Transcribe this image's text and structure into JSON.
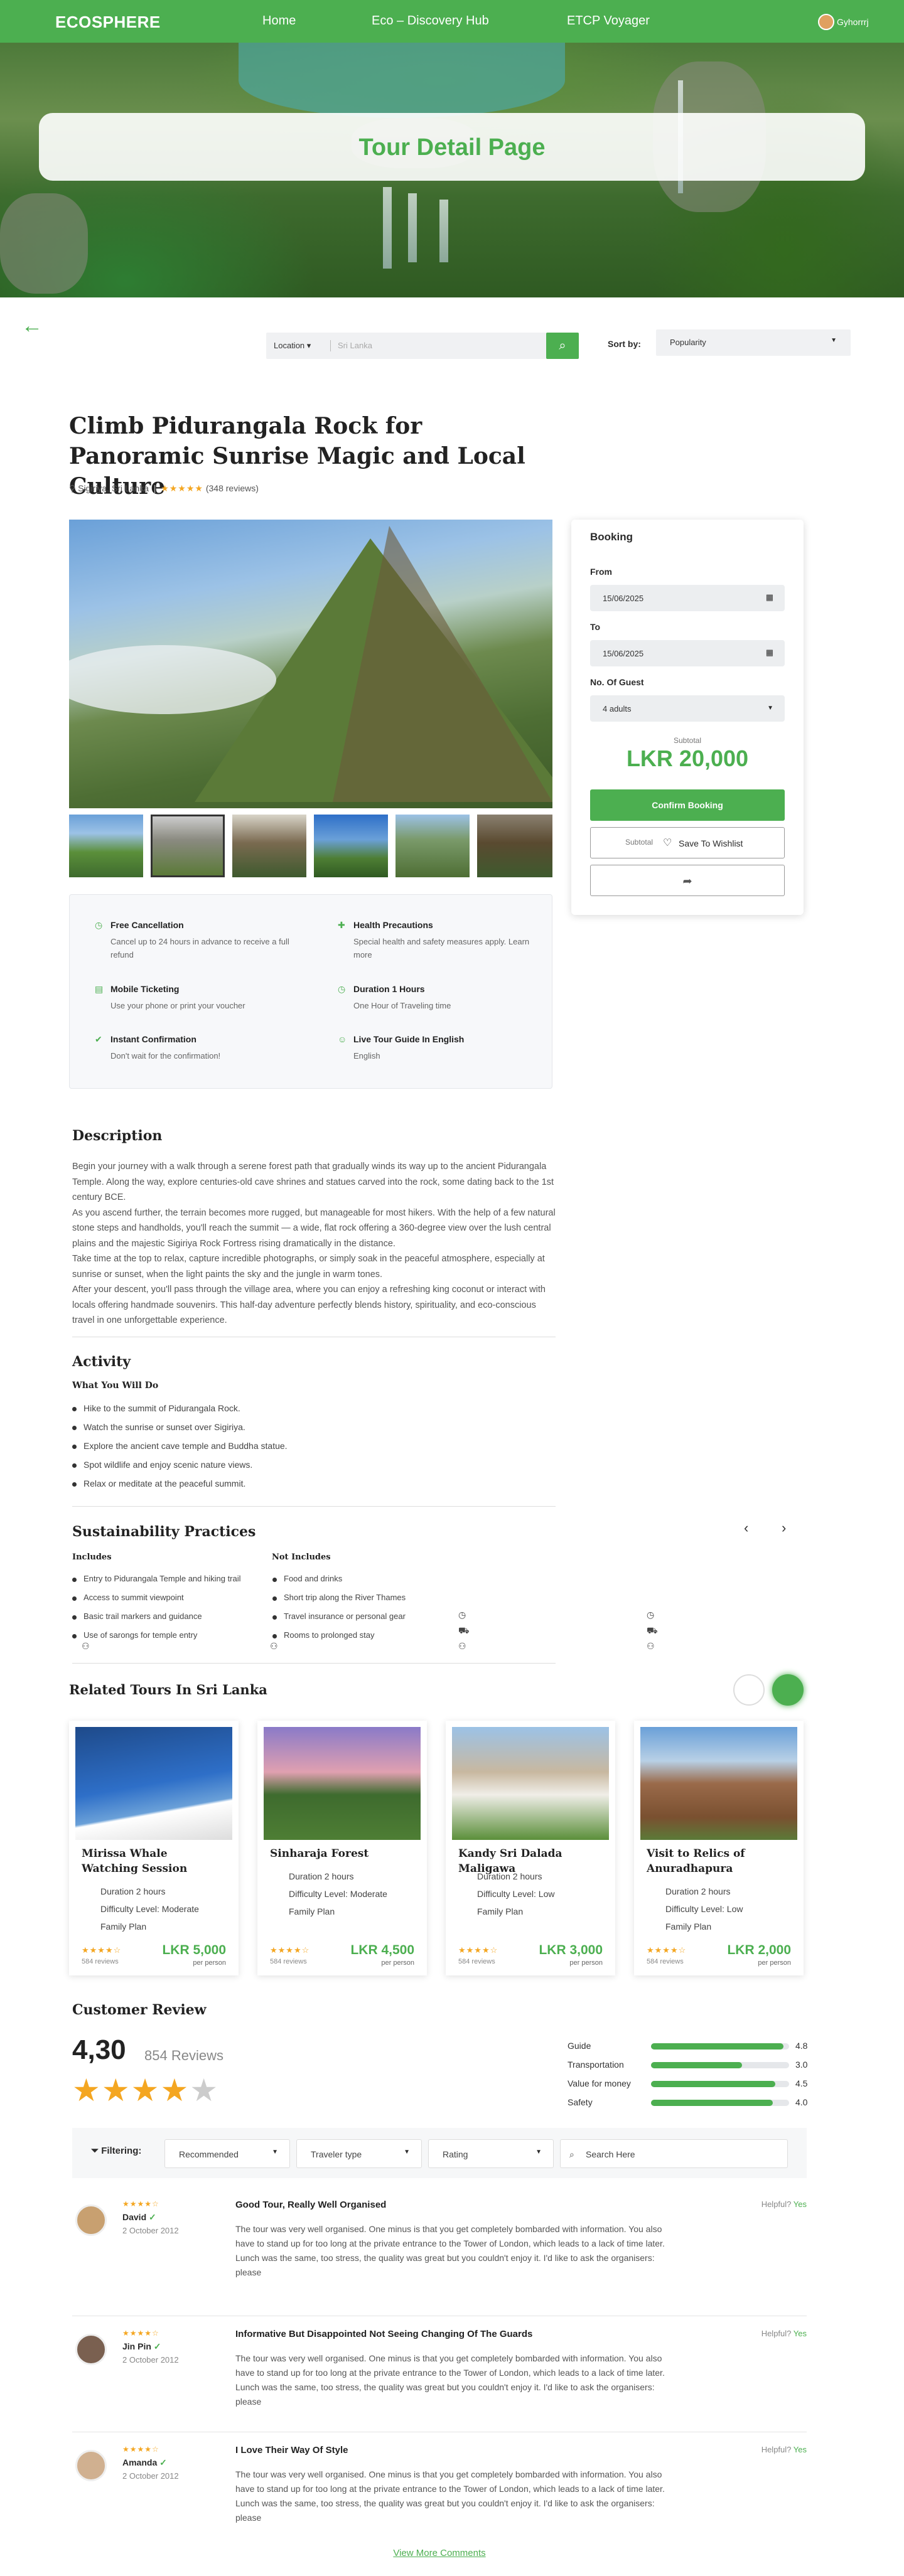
{
  "nav": {
    "logo": "ECOSPHERE",
    "links": [
      "Home",
      "Eco – Discovery Hub",
      "ETCP Voyager"
    ],
    "user": "Gyhorrrj"
  },
  "hero": {
    "title": "Tour Detail Page"
  },
  "search": {
    "location": "Location",
    "placeholder": "Sri Lanka",
    "sort_label": "Sort by:",
    "sort_value": "Popularity"
  },
  "tour": {
    "title": "Climb Pidurangala Rock for Panoramic Sunrise Magic and Local Culture",
    "location": "Sigiriya, Sri Lanka",
    "stars": "★★★★★",
    "reviews": "(348 reviews)"
  },
  "booking": {
    "heading": "Booking",
    "from_label": "From",
    "from": "15/06/2025",
    "to_label": "To",
    "to": "15/06/2025",
    "guest_label": "No. Of Guest",
    "guests": "4 adults",
    "subtotal_label": "Subtotal",
    "price": "LKR 20,000",
    "confirm": "Confirm Booking",
    "wish_sub": "Subtotal",
    "wish": "Save To Wishlist"
  },
  "features": [
    {
      "title": "Free Cancellation",
      "desc": "Cancel up to 24 hours in advance to receive a full refund"
    },
    {
      "title": "Health Precautions",
      "desc": "Special health and safety measures apply. Learn more"
    },
    {
      "title": "Mobile Ticketing",
      "desc": "Use your phone or print your voucher"
    },
    {
      "title": "Duration 1 Hours",
      "desc": "One Hour of Traveling time"
    },
    {
      "title": "Instant Confirmation",
      "desc": "Don't wait for the confirmation!"
    },
    {
      "title": "Live Tour Guide In English",
      "desc": "English"
    }
  ],
  "description": {
    "heading": "Description",
    "text": "Begin your journey with a walk through a serene forest path that gradually winds its way up to the ancient Pidurangala Temple. Along the way, explore centuries-old cave shrines and statues carved into the rock, some dating back to the 1st century BCE.\nAs you ascend further, the terrain becomes more rugged, but manageable for most hikers. With the help of a few natural stone steps and handholds, you'll reach the summit — a wide, flat rock offering a 360-degree view over the lush central plains and the majestic Sigiriya Rock Fortress rising dramatically in the distance.\nTake time at the top to relax, capture incredible photographs, or simply soak in the peaceful atmosphere, especially at sunrise or sunset, when the light paints the sky and the jungle in warm tones.\nAfter your descent, you'll pass through the village area, where you can enjoy a refreshing king coconut or interact with locals offering handmade souvenirs. This half-day adventure perfectly blends history, spirituality, and eco-conscious travel in one unforgettable experience."
  },
  "activity": {
    "heading": "Activity",
    "sub": "What You Will Do",
    "items": [
      "Hike to the summit of Pidurangala Rock.",
      "Watch the sunrise or sunset over Sigiriya.",
      "Explore the ancient cave temple and Buddha statue.",
      "Spot wildlife and enjoy scenic nature views.",
      "Relax or meditate at the peaceful summit."
    ]
  },
  "sustain": {
    "heading": "Sustainability Practices",
    "inc_label": "Includes",
    "inc": [
      "Entry to Pidurangala Temple and hiking trail",
      "Access to summit viewpoint",
      "Basic trail markers and guidance",
      "Use of sarongs for temple entry"
    ],
    "exc_label": "Not Includes",
    "exc": [
      "Food and drinks",
      "Short trip along the River Thames",
      "Travel insurance or personal gear",
      "Rooms to prolonged stay"
    ]
  },
  "related": {
    "heading": "Related Tours In Sri Lanka",
    "cards": [
      {
        "name": "Mirissa Whale Watching Session",
        "duration": "Duration 2 hours",
        "difficulty": "Difficulty Level: Moderate",
        "plan": "Family Plan",
        "stars": "★★★★☆",
        "reviews": "584 reviews",
        "price": "LKR 5,000",
        "per": "per person"
      },
      {
        "name": "Sinharaja Forest",
        "duration": "Duration 2 hours",
        "difficulty": "Difficulty Level: Moderate",
        "plan": "Family Plan",
        "stars": "★★★★☆",
        "reviews": "584 reviews",
        "price": "LKR 4,500",
        "per": "per person"
      },
      {
        "name": "Kandy Sri Dalada Maligawa",
        "duration": "Duration 2 hours",
        "difficulty": "Difficulty Level: Low",
        "plan": "Family Plan",
        "stars": "★★★★☆",
        "reviews": "584 reviews",
        "price": "LKR 3,000",
        "per": "per person"
      },
      {
        "name": "Visit to Relics of Anuradhapura",
        "duration": "Duration 2 hours",
        "difficulty": "Difficulty Level: Low",
        "plan": "Family Plan",
        "stars": "★★★★☆",
        "reviews": "584 reviews",
        "price": "LKR 2,000",
        "per": "per person"
      }
    ]
  },
  "reviews": {
    "heading": "Customer Review",
    "score": "4,30",
    "count": "854 Reviews",
    "ratings": [
      {
        "label": "Guide",
        "value": "4.8",
        "fill": 0.96
      },
      {
        "label": "Transportation",
        "value": "3.0",
        "fill": 0.66
      },
      {
        "label": "Value for money",
        "value": "4.5",
        "fill": 0.9
      },
      {
        "label": "Safety",
        "value": "4.0",
        "fill": 0.88
      }
    ],
    "filter_label": "Filtering:",
    "filters": [
      "Recommended",
      "Traveler type",
      "Rating"
    ],
    "search_ph": "Search Here",
    "items": [
      {
        "stars": "★★★★☆",
        "name": "David",
        "date": "2 October 2012",
        "title": "Good Tour, Really Well Organised",
        "helpful": "Helpful?",
        "yes": "Yes",
        "text": "The tour was very well organised. One minus is that you get completely bombarded with information. You also have to stand up for too long at the private entrance to the Tower of London, which leads to a lack of time later. Lunch was the same, too stress, the quality was great but you couldn't enjoy it. I'd like to ask the organisers: please"
      },
      {
        "stars": "★★★★☆",
        "name": "Jin Pin",
        "date": "2 October 2012",
        "title": "Informative But Disappointed Not Seeing Changing Of The Guards",
        "helpful": "Helpful?",
        "yes": "Yes",
        "text": "The tour was very well organised. One minus is that you get completely bombarded with information. You also have to stand up for too long at the private entrance to the Tower of London, which leads to a lack of time later. Lunch was the same, too stress, the quality was great but you couldn't enjoy it. I'd like to ask the organisers: please"
      },
      {
        "stars": "★★★★☆",
        "name": "Amanda",
        "date": "2 October 2012",
        "title": "I Love Their Way Of Style",
        "helpful": "Helpful?",
        "yes": "Yes",
        "text": "The tour was very well organised. One minus is that you get completely bombarded with information. You also have to stand up for too long at the private entrance to the Tower of London, which leads to a lack of time later. Lunch was the same, too stress, the quality was great but you couldn't enjoy it. I'd like to ask the organisers: please"
      }
    ],
    "more": "View More Comments"
  }
}
